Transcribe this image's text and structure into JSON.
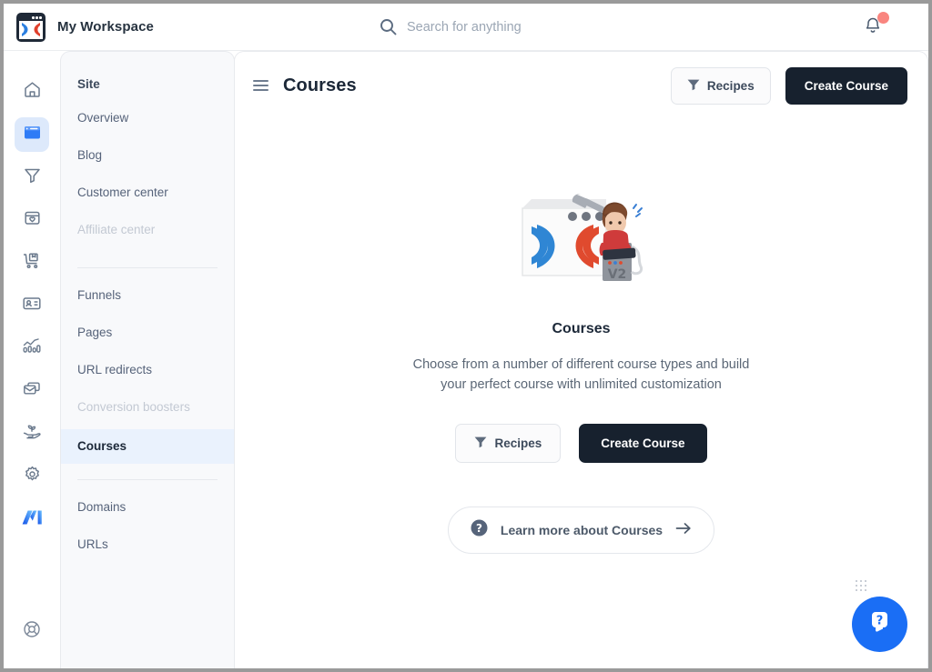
{
  "topbar": {
    "workspace_title": "My Workspace",
    "logo_icon": "workspace-browser-logo-icon",
    "search": {
      "placeholder": "Search for anything",
      "value": "",
      "icon": "search-icon"
    },
    "notifications": {
      "icon": "bell-icon",
      "has_unread": true,
      "dot_color": "#f9857f"
    }
  },
  "rail": {
    "items": [
      {
        "name": "home",
        "icon": "home-icon",
        "active": false
      },
      {
        "name": "site",
        "icon": "browser-window-icon",
        "active": true
      },
      {
        "name": "funnels",
        "icon": "funnel-icon",
        "active": false
      },
      {
        "name": "products",
        "icon": "box-heart-icon",
        "active": false
      },
      {
        "name": "orders",
        "icon": "shopping-cart-icon",
        "active": false
      },
      {
        "name": "contacts",
        "icon": "contact-card-icon",
        "active": false
      },
      {
        "name": "analytics",
        "icon": "bar-chart-trend-icon",
        "active": false
      },
      {
        "name": "marketing",
        "icon": "email-stack-icon",
        "active": false
      },
      {
        "name": "growth",
        "icon": "plant-hand-icon",
        "active": false
      },
      {
        "name": "settings",
        "icon": "gear-icon",
        "active": false
      },
      {
        "name": "ai",
        "icon": "ai-logo-icon",
        "active": false
      }
    ],
    "bottom": {
      "name": "support",
      "icon": "lifebuoy-icon"
    },
    "active_bg": "#dde9fb",
    "active_fg": "#1b6ef3"
  },
  "subnav": {
    "groups": [
      {
        "heading": "Site",
        "items": [
          {
            "label": "Overview",
            "state": "normal"
          },
          {
            "label": "Blog",
            "state": "normal"
          },
          {
            "label": "Customer center",
            "state": "normal"
          },
          {
            "label": "Affiliate center",
            "state": "disabled"
          }
        ]
      },
      {
        "heading": "",
        "items": [
          {
            "label": "Funnels",
            "state": "normal"
          },
          {
            "label": "Pages",
            "state": "normal"
          },
          {
            "label": "URL redirects",
            "state": "normal"
          },
          {
            "label": "Conversion boosters",
            "state": "disabled"
          },
          {
            "label": "Courses",
            "state": "active"
          }
        ]
      },
      {
        "heading": "",
        "items": [
          {
            "label": "Domains",
            "state": "normal"
          },
          {
            "label": "URLs",
            "state": "normal"
          }
        ]
      }
    ],
    "active_bg": "#eaf2fd"
  },
  "main": {
    "menu_icon": "hamburger-menu-icon",
    "page_title": "Courses",
    "header_actions": {
      "recipes_label": "Recipes",
      "recipes_icon": "funnel-filter-icon",
      "create_label": "Create Course"
    }
  },
  "empty_state": {
    "illustration_icon": "course-builder-illustration",
    "illustration_caption": "V2",
    "title": "Courses",
    "description": "Choose from a number of different course types and build your perfect course with unlimited customization",
    "recipes_label": "Recipes",
    "recipes_icon": "funnel-filter-icon",
    "create_label": "Create Course",
    "learn_more": {
      "icon": "question-circle-icon",
      "label": "Learn more about Courses",
      "arrow_icon": "arrow-right-icon"
    }
  },
  "chat_widget": {
    "icon": "chat-help-bubble-icon",
    "color": "#1a6ef5",
    "drag_handle_icon": "drag-dots-icon"
  }
}
